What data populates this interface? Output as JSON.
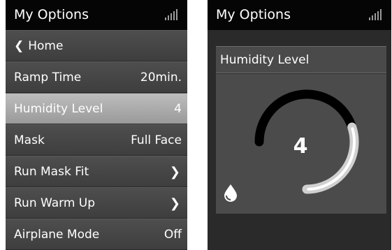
{
  "left_screen": {
    "header": {
      "title": "My Options"
    },
    "menu": [
      {
        "label": "Home",
        "back_icon": "chevron-left-icon"
      },
      {
        "label": "Ramp Time",
        "value": "20min."
      },
      {
        "label": "Humidity Level",
        "value": "4",
        "selected": true
      },
      {
        "label": "Mask",
        "value": "Full Face"
      },
      {
        "label": "Run Mask Fit",
        "action_icon": "chevron-right-icon"
      },
      {
        "label": "Run Warm Up",
        "action_icon": "chevron-right-icon"
      },
      {
        "label": "Airplane Mode",
        "value": "Off"
      }
    ]
  },
  "right_screen": {
    "header": {
      "title": "My Options"
    },
    "setting_title": "Humidity Level",
    "humidity": {
      "value": "4",
      "level_fraction": 0.4,
      "icon": "water-drop-icon"
    }
  },
  "colors": {
    "header_bg": "#050505",
    "row_bg": "#454545",
    "selected_row_bg": "#acacac",
    "arc_fill": "#d0d0d0",
    "arc_track": "#000000"
  }
}
